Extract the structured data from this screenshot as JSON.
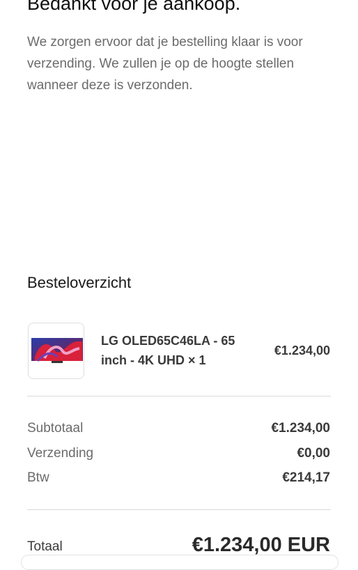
{
  "confirmation": {
    "title": "Bedankt voor je aankoop.",
    "message": "We zorgen ervoor dat je bestelling klaar is voor verzending. We zullen je op de hoogte stellen wanneer deze is verzonden."
  },
  "summary": {
    "title": "Besteloverzicht",
    "item": {
      "name": "LG OLED65C46LA - 65 inch - 4K UHD × 1",
      "price": "€1.234,00",
      "image_icon": "tv-product-image"
    },
    "lines": [
      {
        "label": "Subtotaal",
        "value": "€1.234,00"
      },
      {
        "label": "Verzending",
        "value": "€0,00"
      },
      {
        "label": "Btw",
        "value": "€214,17"
      }
    ],
    "total": {
      "label": "Totaal",
      "value": "€1.234,00 EUR"
    }
  }
}
